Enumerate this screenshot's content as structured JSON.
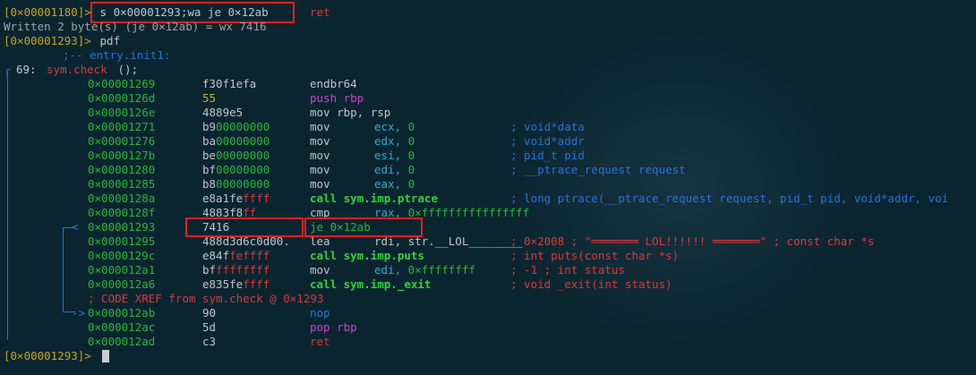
{
  "lines": {
    "l1": {
      "prompt": "[0×00001180]>",
      "cmd": " s 0×00001293;wa je 0×12ab",
      "tail": "ret"
    },
    "l2": {
      "text": "Written 2 byte(s) (je 0×12ab) = wx 7416"
    },
    "l3": {
      "prompt": "[0×00001293]>",
      "cmd": " pdf"
    },
    "l4": {
      "text": ";-- entry.init1:"
    },
    "l5": {
      "num": "69:",
      "func": "sym.check",
      "args": " ();"
    }
  },
  "rows": [
    {
      "addr": "0×00001269",
      "bytes_a": "f30f1efa",
      "bytes_b": "",
      "mnemonic": "endbr64",
      "operands": "",
      "comment": ""
    },
    {
      "addr": "0×0000126d",
      "bytes_a": "55",
      "bytes_b": "",
      "mnemonic": "push rbp",
      "operands": "",
      "comment": ""
    },
    {
      "addr": "0×0000126e",
      "bytes_a": "4889e5",
      "bytes_b": "",
      "mnemonic": "mov rbp, rsp",
      "operands": "",
      "comment": ""
    },
    {
      "addr": "0×00001271",
      "bytes_a": "b9",
      "bytes_b": "00000000",
      "mnemonic": "mov",
      "operands": "ecx, 0",
      "comment": "; void*data"
    },
    {
      "addr": "0×00001276",
      "bytes_a": "ba",
      "bytes_b": "00000000",
      "mnemonic": "mov",
      "operands": "edx, 0",
      "comment": "; void*addr"
    },
    {
      "addr": "0×0000127b",
      "bytes_a": "be",
      "bytes_b": "00000000",
      "mnemonic": "mov",
      "operands": "esi, 0",
      "comment": "; pid_t pid"
    },
    {
      "addr": "0×00001280",
      "bytes_a": "bf",
      "bytes_b": "00000000",
      "mnemonic": "mov",
      "operands": "edi, 0",
      "comment": "; __ptrace_request request"
    },
    {
      "addr": "0×00001285",
      "bytes_a": "b8",
      "bytes_b": "00000000",
      "mnemonic": "mov",
      "operands": "eax, 0",
      "comment": ""
    },
    {
      "addr": "0×0000128a",
      "bytes_a": "e8a1fe",
      "bytes_b": "ffff",
      "mnemonic": "call sym.imp.ptrace",
      "operands": "",
      "comment": "; long ptrace(__ptrace_request request, pid_t pid, void*addr, voi"
    },
    {
      "addr": "0×0000128f",
      "bytes_a": "4883f8",
      "bytes_b": "ff",
      "mnemonic": "cmp",
      "operands": "rax, 0×ffffffffffffffff",
      "comment": ""
    },
    {
      "addr": "0×00001293",
      "bytes_a": "7416",
      "bytes_b": "",
      "mnemonic": "je 0×12ab",
      "operands": "",
      "comment": ""
    },
    {
      "addr": "0×00001295",
      "bytes_a": "488d3d6c0d00.",
      "bytes_b": "",
      "mnemonic": "lea",
      "operands": "rdi, str.__LOL________",
      "comment": "; 0×2008 ; \"═══════ LOL!!!!!! ═══════\" ; const char *s"
    },
    {
      "addr": "0×0000129c",
      "bytes_a": "e84f",
      "bytes_b": "feffff",
      "mnemonic": "call sym.imp.puts",
      "operands": "",
      "comment": "; int puts(const char *s)"
    },
    {
      "addr": "0×000012a1",
      "bytes_a": "bf",
      "bytes_b": "ffffffff",
      "mnemonic": "mov",
      "operands": "edi, 0×ffffffff",
      "comment": "; -1 ; int status"
    },
    {
      "addr": "0×000012a6",
      "bytes_a": "e835fe",
      "bytes_b": "ffff",
      "mnemonic": "call sym.imp._exit",
      "operands": "",
      "comment": "; void _exit(int status)"
    },
    {
      "xref": "; CODE XREF from sym.check @ 0×1293"
    },
    {
      "addr": "0×000012ab",
      "bytes_a": "90",
      "bytes_b": "",
      "mnemonic": "nop",
      "operands": "",
      "comment": ""
    },
    {
      "addr": "0×000012ac",
      "bytes_a": "5d",
      "bytes_b": "",
      "mnemonic": "pop rbp",
      "operands": "",
      "comment": ""
    },
    {
      "addr": "0×000012ad",
      "bytes_a": "c3",
      "bytes_b": "",
      "mnemonic": "ret",
      "operands": "",
      "comment": ""
    }
  ],
  "jump_arrow_from": "<",
  "jump_arrow_to": "->",
  "final_prompt": "[0×00001293]>",
  "colors": {
    "highlight_box": "#e02020",
    "background": "#0b2530"
  }
}
